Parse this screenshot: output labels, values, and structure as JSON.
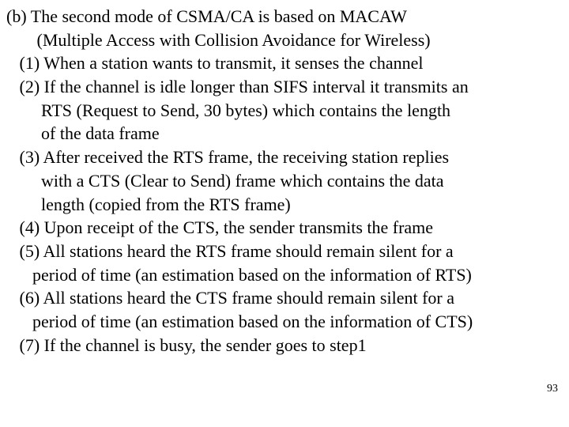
{
  "slide": {
    "lines": [
      "(b) The second mode of CSMA/CA is based on MACAW",
      "       (Multiple Access with Collision Avoidance for Wireless)",
      "   (1) When a station wants to transmit, it senses the channel",
      "   (2) If the channel is idle longer than SIFS interval it transmits an",
      "        RTS (Request to Send, 30 bytes) which contains the length",
      "        of the data frame",
      "   (3) After received the RTS frame, the receiving station replies",
      "        with a CTS (Clear to Send) frame which contains the data",
      "        length (copied from the RTS frame)",
      "   (4) Upon receipt of the CTS, the sender transmits the frame",
      "   (5) All stations heard the RTS frame should remain silent for a",
      "      period of time (an estimation based on the information of RTS)",
      "   (6) All stations heard the CTS frame should remain silent for a",
      "      period of time (an estimation based on the information of CTS)",
      "   (7) If the channel is busy, the sender goes to step1"
    ],
    "page_number": "93"
  }
}
